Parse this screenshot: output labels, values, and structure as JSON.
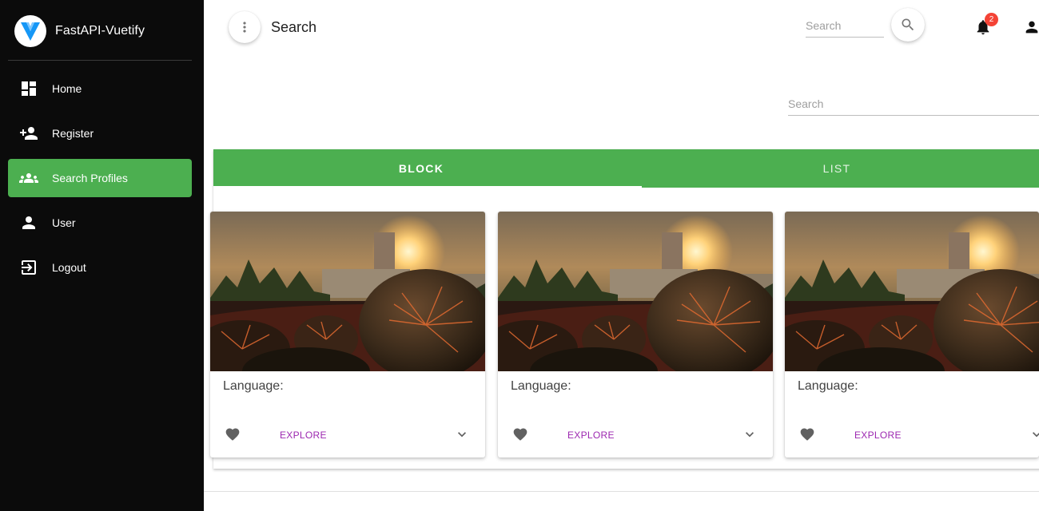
{
  "app": {
    "title": "FastAPI-Vuetify",
    "logo_icon": "vuetify-logo-icon"
  },
  "sidebar": {
    "items": [
      {
        "label": "Home",
        "icon": "dashboard-icon",
        "active": false
      },
      {
        "label": "Register",
        "icon": "person-add-icon",
        "active": false
      },
      {
        "label": "Search Profiles",
        "icon": "group-icon",
        "active": true
      },
      {
        "label": "User",
        "icon": "person-icon",
        "active": false
      },
      {
        "label": "Logout",
        "icon": "logout-icon",
        "active": false
      }
    ]
  },
  "toolbar": {
    "page_title": "Search",
    "search_placeholder": "Search",
    "notification_count": "2"
  },
  "main": {
    "search_placeholder": "Search",
    "tabs": [
      {
        "label": "BLOCK",
        "active": true
      },
      {
        "label": "LIST",
        "active": false
      }
    ],
    "cards": [
      {
        "text": "Language:",
        "action_label": "EXPLORE"
      },
      {
        "text": "Language:",
        "action_label": "EXPLORE"
      },
      {
        "text": "Language:",
        "action_label": "EXPLORE"
      }
    ]
  },
  "colors": {
    "sidebar_bg": "#0b0b0b",
    "accent": "#4caf50",
    "link": "#9c27b0",
    "badge": "#f44336"
  }
}
